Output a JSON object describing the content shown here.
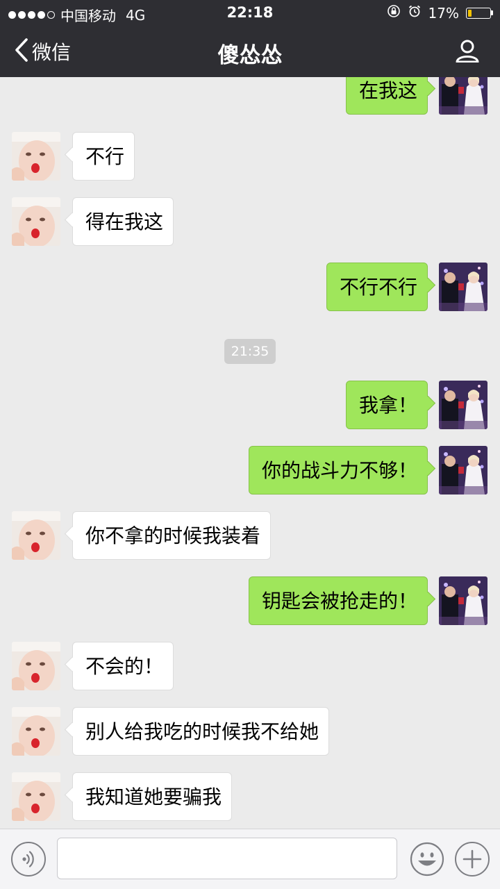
{
  "status_bar": {
    "carrier": "中国移动",
    "network": "4G",
    "time": "22:18",
    "battery_percent": "17%",
    "battery_level": 0.17,
    "signal_bars_filled": 4,
    "signal_bars_total": 5,
    "icons": [
      "orientation-lock-icon",
      "alarm-icon",
      "battery-icon"
    ]
  },
  "nav": {
    "back_label": "微信",
    "title": "傻怂怂"
  },
  "chat": {
    "timestamp": "21:35",
    "messages": [
      {
        "side": "out",
        "text": "在我这"
      },
      {
        "side": "in",
        "text": "不行"
      },
      {
        "side": "in",
        "text": "得在我这"
      },
      {
        "side": "out",
        "text": "不行不行"
      },
      {
        "side": "out",
        "text": "我拿！"
      },
      {
        "side": "out",
        "text": "你的战斗力不够！"
      },
      {
        "side": "in",
        "text": "你不拿的时候我装着"
      },
      {
        "side": "out",
        "text": "钥匙会被抢走的！"
      },
      {
        "side": "in",
        "text": "不会的！"
      },
      {
        "side": "in",
        "text": "别人给我吃的时候我不给她"
      },
      {
        "side": "in",
        "text": "我知道她要骗我"
      }
    ]
  },
  "input_bar": {
    "placeholder": "",
    "icons": [
      "voice-icon",
      "emoji-icon",
      "plus-icon"
    ]
  },
  "colors": {
    "nav_background": "#2e2e33",
    "chat_background": "#ebebeb",
    "outgoing_bubble": "#9fe65b",
    "incoming_bubble": "#ffffff"
  }
}
